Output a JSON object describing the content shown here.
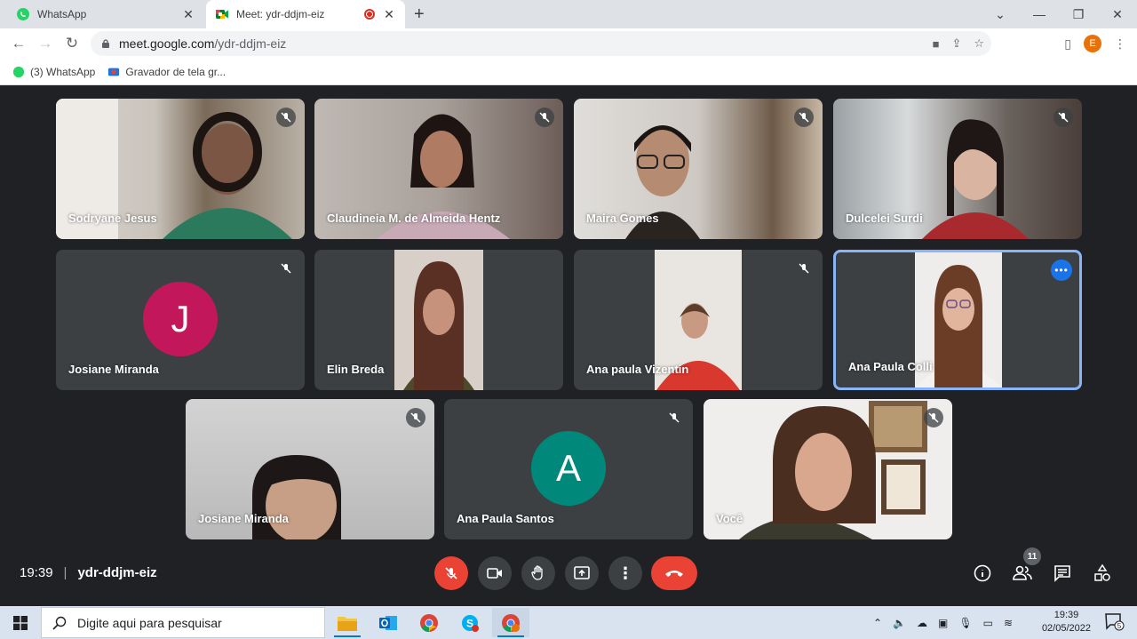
{
  "browser": {
    "tabs": [
      {
        "title": "WhatsApp",
        "icon": "whatsapp-icon",
        "active": false
      },
      {
        "title": "Meet: ydr-ddjm-eiz",
        "icon": "google-meet-icon",
        "active": true,
        "recording": true
      }
    ],
    "url_host": "meet.google.com",
    "url_path": "/ydr-ddjm-eiz",
    "profile_initial": "E",
    "bookmarks": [
      {
        "label": "(3) WhatsApp",
        "icon": "whatsapp-icon"
      },
      {
        "label": "Gravador de tela gr...",
        "icon": "screen-recorder-icon"
      }
    ]
  },
  "meet": {
    "participants": [
      {
        "name": "Sodryane Jesus",
        "muted": true,
        "type": "video"
      },
      {
        "name": "Claudineia M. de Almeida Hentz",
        "muted": true,
        "type": "video"
      },
      {
        "name": "Maira Gomes",
        "muted": true,
        "type": "video"
      },
      {
        "name": "Dulcelei Surdi",
        "muted": true,
        "type": "video"
      },
      {
        "name": "Josiane Miranda",
        "muted": true,
        "type": "avatar",
        "initial": "J",
        "avatar_color": "#c2185b"
      },
      {
        "name": "Elin Breda",
        "muted": false,
        "type": "video"
      },
      {
        "name": "Ana paula Vizentin",
        "muted": true,
        "type": "video"
      },
      {
        "name": "Ana Paula Colli",
        "muted": false,
        "type": "video",
        "speaking": true
      },
      {
        "name": "Josiane Miranda",
        "muted": true,
        "type": "video"
      },
      {
        "name": "Ana Paula Santos",
        "muted": true,
        "type": "avatar",
        "initial": "A",
        "avatar_color": "#00897b"
      },
      {
        "name": "Você",
        "muted": true,
        "type": "video"
      }
    ],
    "time": "19:39",
    "meeting_code": "ydr-ddjm-eiz",
    "participant_count": "11"
  },
  "taskbar": {
    "search_placeholder": "Digite aqui para pesquisar",
    "time": "19:39",
    "date": "02/05/2022",
    "notification_count": "5"
  },
  "colors": {
    "meet_bg": "#202124",
    "tile_bg": "#3c4043",
    "danger": "#ea4335",
    "accent": "#1a73e8"
  }
}
